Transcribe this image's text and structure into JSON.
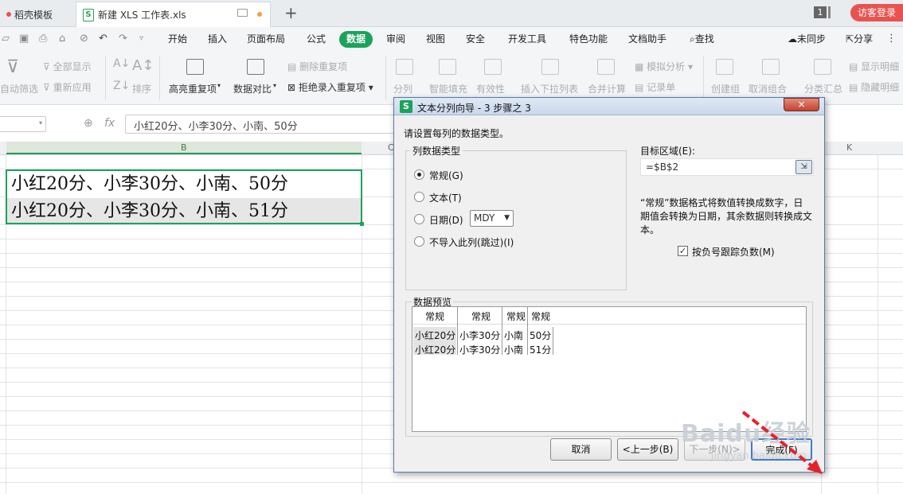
{
  "tabs": [
    {
      "label": "稻壳模板",
      "active": false
    },
    {
      "label": "新建 XLS 工作表.xls",
      "active": true
    }
  ],
  "topright": {
    "page_badge": "1",
    "login": "访客登录"
  },
  "menu": {
    "items": [
      "开始",
      "插入",
      "页面布局",
      "公式",
      "数据",
      "审阅",
      "视图",
      "安全",
      "开发工具",
      "特色功能",
      "文档助手"
    ],
    "active": "数据",
    "search": "查找",
    "sync": "未同步",
    "share": "分享"
  },
  "ribbon": {
    "show_all": "全部显示",
    "reapply": "重新应用",
    "auto_filter": "自动筛选",
    "sort": "排序",
    "highlight_dup": "高亮重复项",
    "data_compare": "数据对比",
    "remove_dup": "删除重复项",
    "reject_dup": "拒绝录入重复项",
    "split": "分列",
    "smart_fill": "智能填充",
    "validity": "有效性",
    "insert_dropdown": "插入下拉列表",
    "consolidate": "合并计算",
    "simulate": "模拟分析",
    "record": "记录单",
    "create_group": "创建组",
    "ungroup": "取消组合",
    "subtotal": "分类汇总",
    "show_detail": "显示明细",
    "hide_detail": "隐藏明细"
  },
  "formula_bar": {
    "fx": "fx",
    "content": "小红20分、小李30分、小南、50分"
  },
  "sheet": {
    "columns": [
      "B",
      "C",
      "K"
    ],
    "cells": [
      "小红20分、小李30分、小南、50分",
      "小红20分、小李30分、小南、51分"
    ]
  },
  "dialog": {
    "title": "文本分列向导 - 3 步骤之 3",
    "instruction": "请设置每列的数据类型。",
    "col_type_group": "列数据类型",
    "options": [
      "常规(G)",
      "文本(T)",
      "日期(D)",
      "不导入此列(跳过)(I)"
    ],
    "selected_option": "常规(G)",
    "date_format": "MDY",
    "target_label": "目标区域(E):",
    "target_value": "=$B$2",
    "description": [
      "“常规”数据格式将数值转换成数字，日",
      "期值会转换为日期，其余数据则转换成文",
      "本。"
    ],
    "negative_label": "按负号跟踪负数(M)",
    "negative_checked": true,
    "preview_label": "数据预览",
    "preview_headers": [
      "常规",
      "常规",
      "常规",
      "常规"
    ],
    "preview_rows": [
      [
        "小红20分",
        "小李30分",
        "小南",
        "50分"
      ],
      [
        "小红20分",
        "小李30分",
        "小南",
        "51分"
      ]
    ],
    "buttons": {
      "cancel": "取消",
      "back": "<上一步(B)",
      "next": "下一步(N)>",
      "finish": "完成(F)"
    }
  },
  "watermark": {
    "text": "Baidu经验",
    "url": "jingyan.baidu.com"
  },
  "colors": {
    "accent": "#1aa35a",
    "login_bg": "#e9534f",
    "arrow": "#e8202a"
  }
}
